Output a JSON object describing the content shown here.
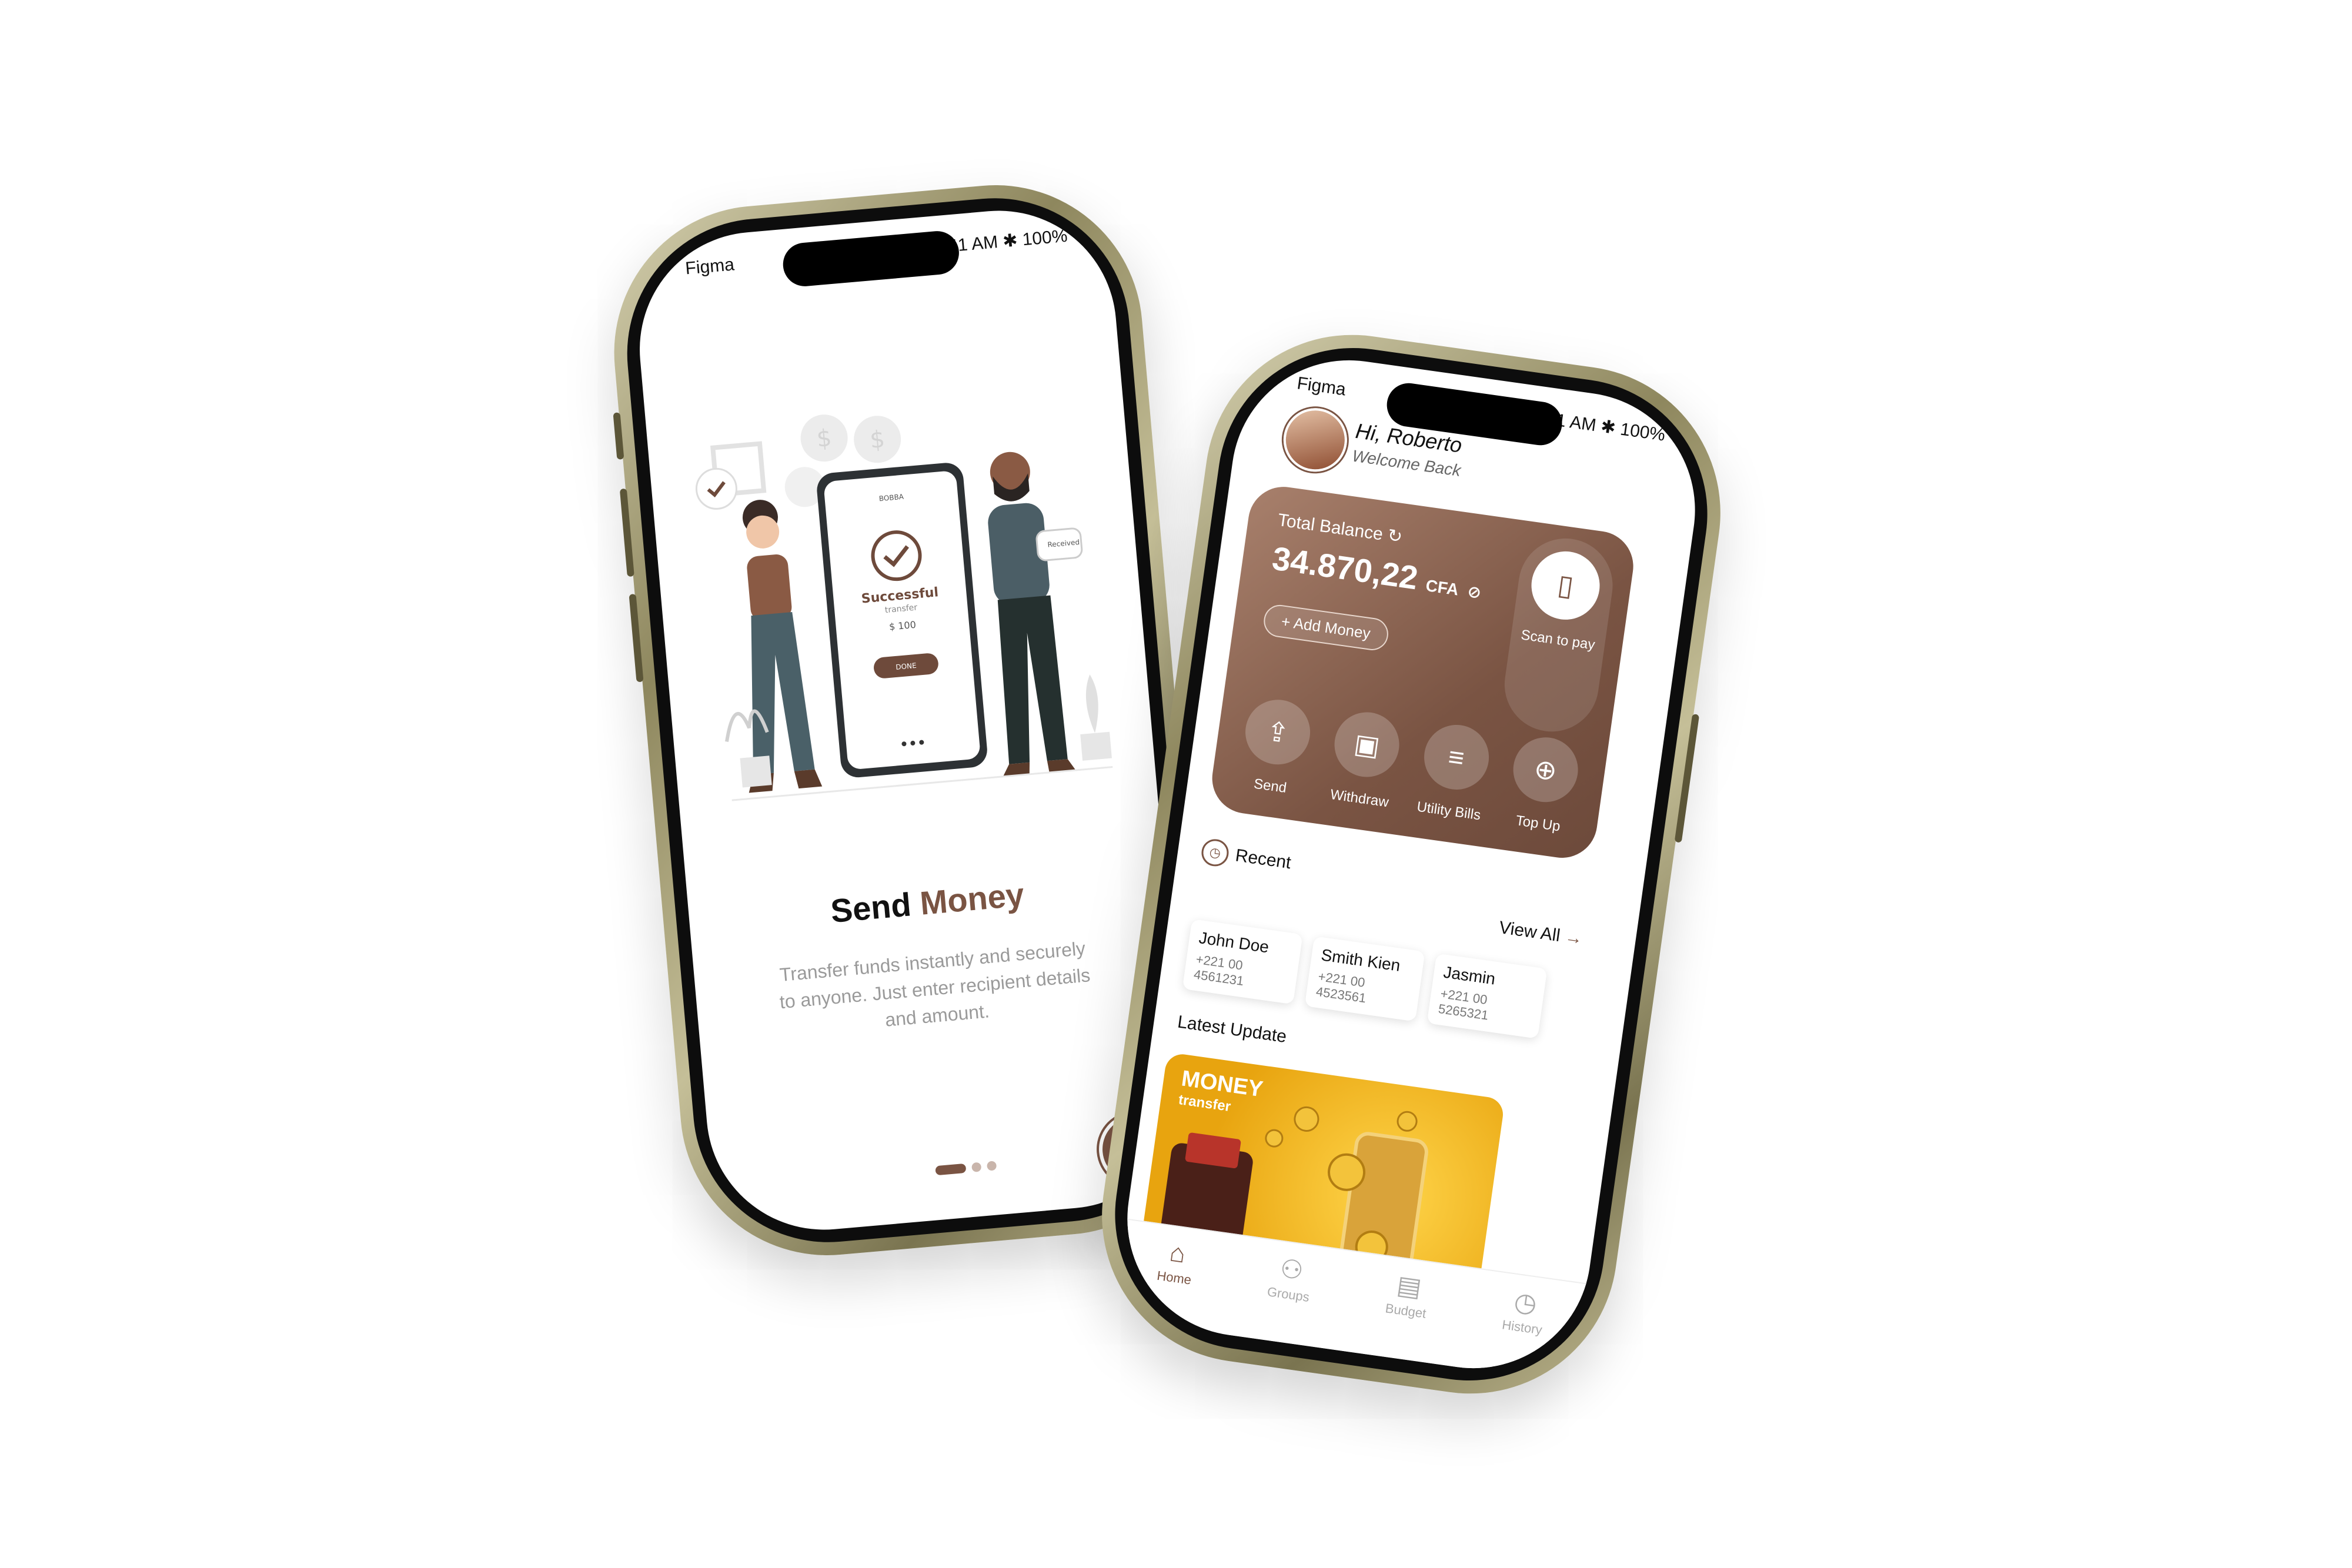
{
  "onboarding": {
    "status_left": "Figma",
    "status_time": "9:41 AM",
    "status_battery": "100%",
    "illus_phone_header": "BOBBA",
    "illus_success": "Successful",
    "illus_transfer": "transfer",
    "illus_amount": "$ 100",
    "illus_done": "DONE",
    "illus_received": "Received",
    "title_part1": "Send",
    "title_part2": "Money",
    "description": "Transfer funds instantly and securely to anyone. Just enter recipient details and amount.",
    "page_indicator": {
      "current": 1,
      "total": 3
    }
  },
  "home": {
    "status_left": "Figma",
    "status_time": "9:41 AM",
    "status_battery": "100%",
    "greeting": "Hi, Roberto",
    "welcome": "Welcome Back",
    "balance_label": "Total Balance",
    "balance_amount": "34.870,22",
    "balance_currency": "CFA",
    "add_money": "+ Add Money",
    "scan_label": "Scan to pay",
    "actions": [
      {
        "label": "Send",
        "icon": "send-money-icon"
      },
      {
        "label": "Withdraw",
        "icon": "withdraw-icon"
      },
      {
        "label": "Utility Bills",
        "icon": "bill-icon"
      },
      {
        "label": "Top Up",
        "icon": "top-up-icon"
      }
    ],
    "recent_label": "Recent",
    "view_all": "View All",
    "contacts": [
      {
        "name": "John Doe",
        "phone": "+221 00 4561231"
      },
      {
        "name": "Smith Kien",
        "phone": "+221 00 4523561"
      },
      {
        "name": "Jasmin",
        "phone": "+221 00 5265321"
      }
    ],
    "latest_update": "Latest Update",
    "banner_title": "MONEY",
    "banner_sub": "transfer",
    "tabs": [
      {
        "label": "Home",
        "icon": "home-icon",
        "active": true
      },
      {
        "label": "Groups",
        "icon": "groups-icon"
      },
      {
        "label": "Budget",
        "icon": "budget-icon"
      },
      {
        "label": "History",
        "icon": "history-icon"
      }
    ]
  },
  "colors": {
    "accent": "#7a5443",
    "accent_light": "#a8806c",
    "banner": "#f0b41c"
  }
}
